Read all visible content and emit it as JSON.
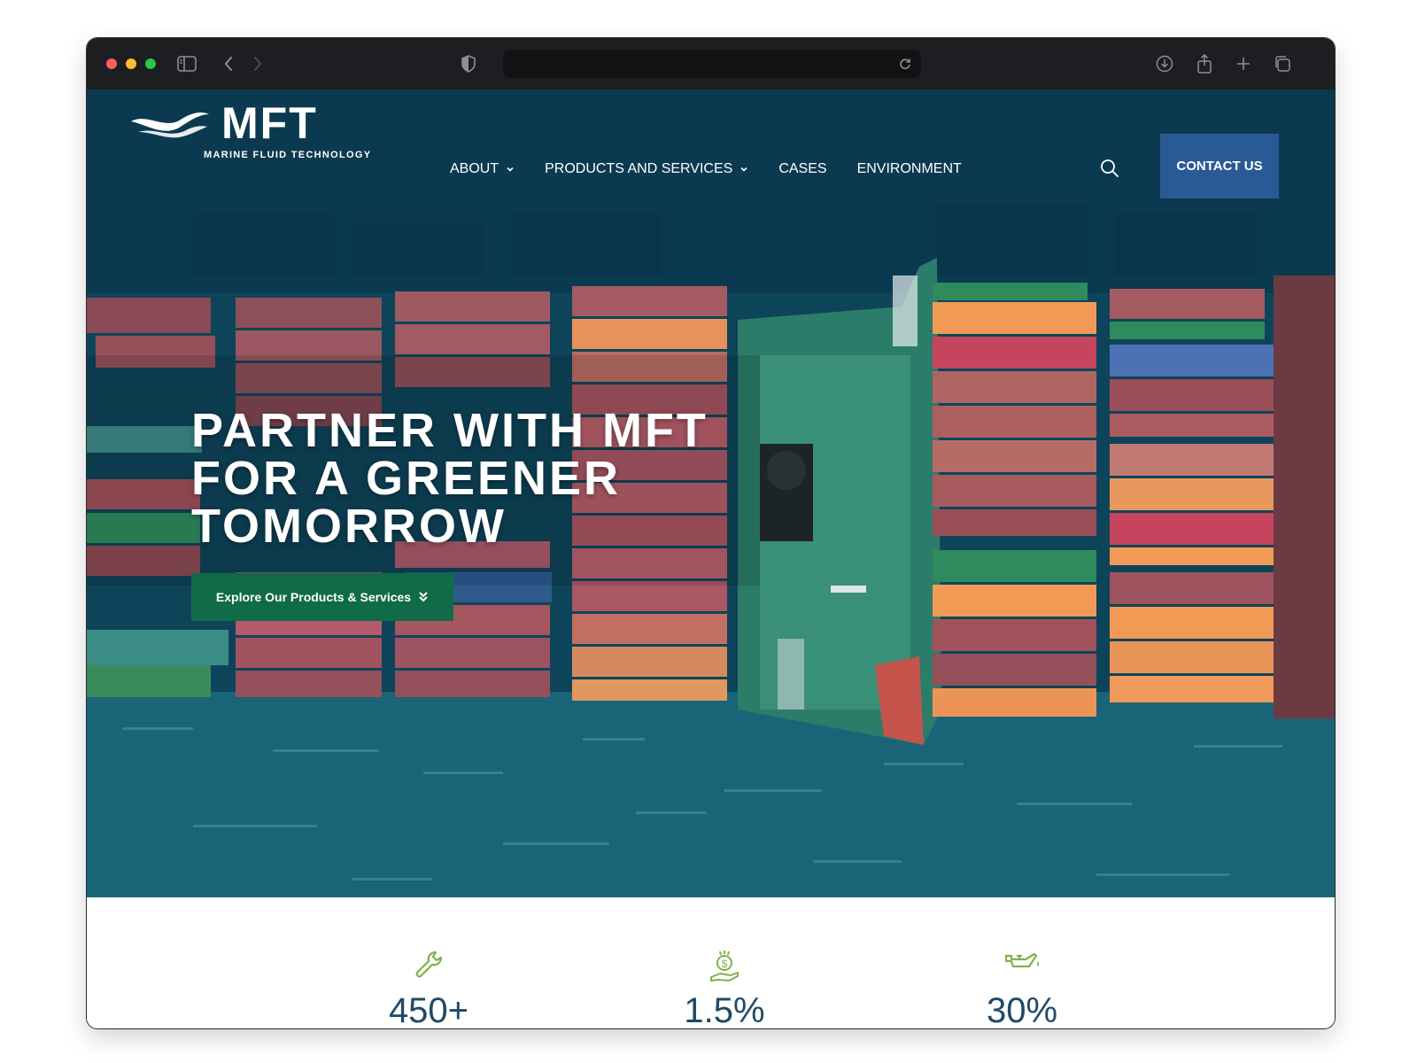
{
  "site": {
    "logo_text": "MFT",
    "logo_tagline": "MARINE FLUID TECHNOLOGY"
  },
  "nav": {
    "items": [
      {
        "label": "ABOUT",
        "has_dropdown": true
      },
      {
        "label": "PRODUCTS AND SERVICES",
        "has_dropdown": true
      },
      {
        "label": "CASES",
        "has_dropdown": false
      },
      {
        "label": "ENVIRONMENT",
        "has_dropdown": false
      }
    ],
    "contact_label": "CONTACT US"
  },
  "hero": {
    "title": "PARTNER WITH MFT FOR A GREENER TOMORROW",
    "cta_label": "Explore Our Products & Services"
  },
  "stats": [
    {
      "icon": "wrench-icon",
      "value": "450+"
    },
    {
      "icon": "money-hand-icon",
      "value": "1.5%"
    },
    {
      "icon": "oil-can-icon",
      "value": "30%"
    }
  ],
  "colors": {
    "contact_button": "#2a5a96",
    "cta_button": "#0f6b48",
    "stat_icon": "#7fb24b",
    "stat_value": "#1f4a66",
    "chrome": "#1d1e21"
  }
}
